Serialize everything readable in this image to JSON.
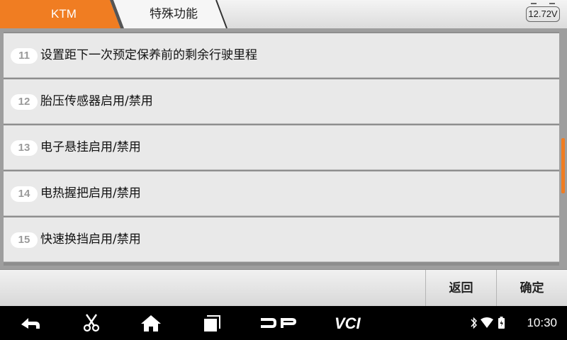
{
  "header": {
    "breadcrumbs": [
      "KTM",
      "特殊功能"
    ],
    "battery_voltage": "12.72V"
  },
  "list": {
    "items": [
      {
        "num": "11",
        "label": "设置距下一次预定保养前的剩余行驶里程"
      },
      {
        "num": "12",
        "label": "胎压传感器启用/禁用"
      },
      {
        "num": "13",
        "label": "电子悬挂启用/禁用"
      },
      {
        "num": "14",
        "label": "电热握把启用/禁用"
      },
      {
        "num": "15",
        "label": "快速换挡启用/禁用"
      }
    ]
  },
  "actions": {
    "back_label": "返回",
    "confirm_label": "确定"
  },
  "navbar": {
    "icons": [
      "back-icon",
      "scissors-icon",
      "home-icon",
      "recent-apps-icon",
      "dp-icon",
      "vci-icon"
    ],
    "status_icons": [
      "bluetooth-icon",
      "wifi-icon",
      "battery-charging-icon"
    ],
    "time": "10:30"
  },
  "colors": {
    "accent": "#f07d22",
    "list_bg": "#e9e9e9",
    "navbar_bg": "#000000"
  }
}
